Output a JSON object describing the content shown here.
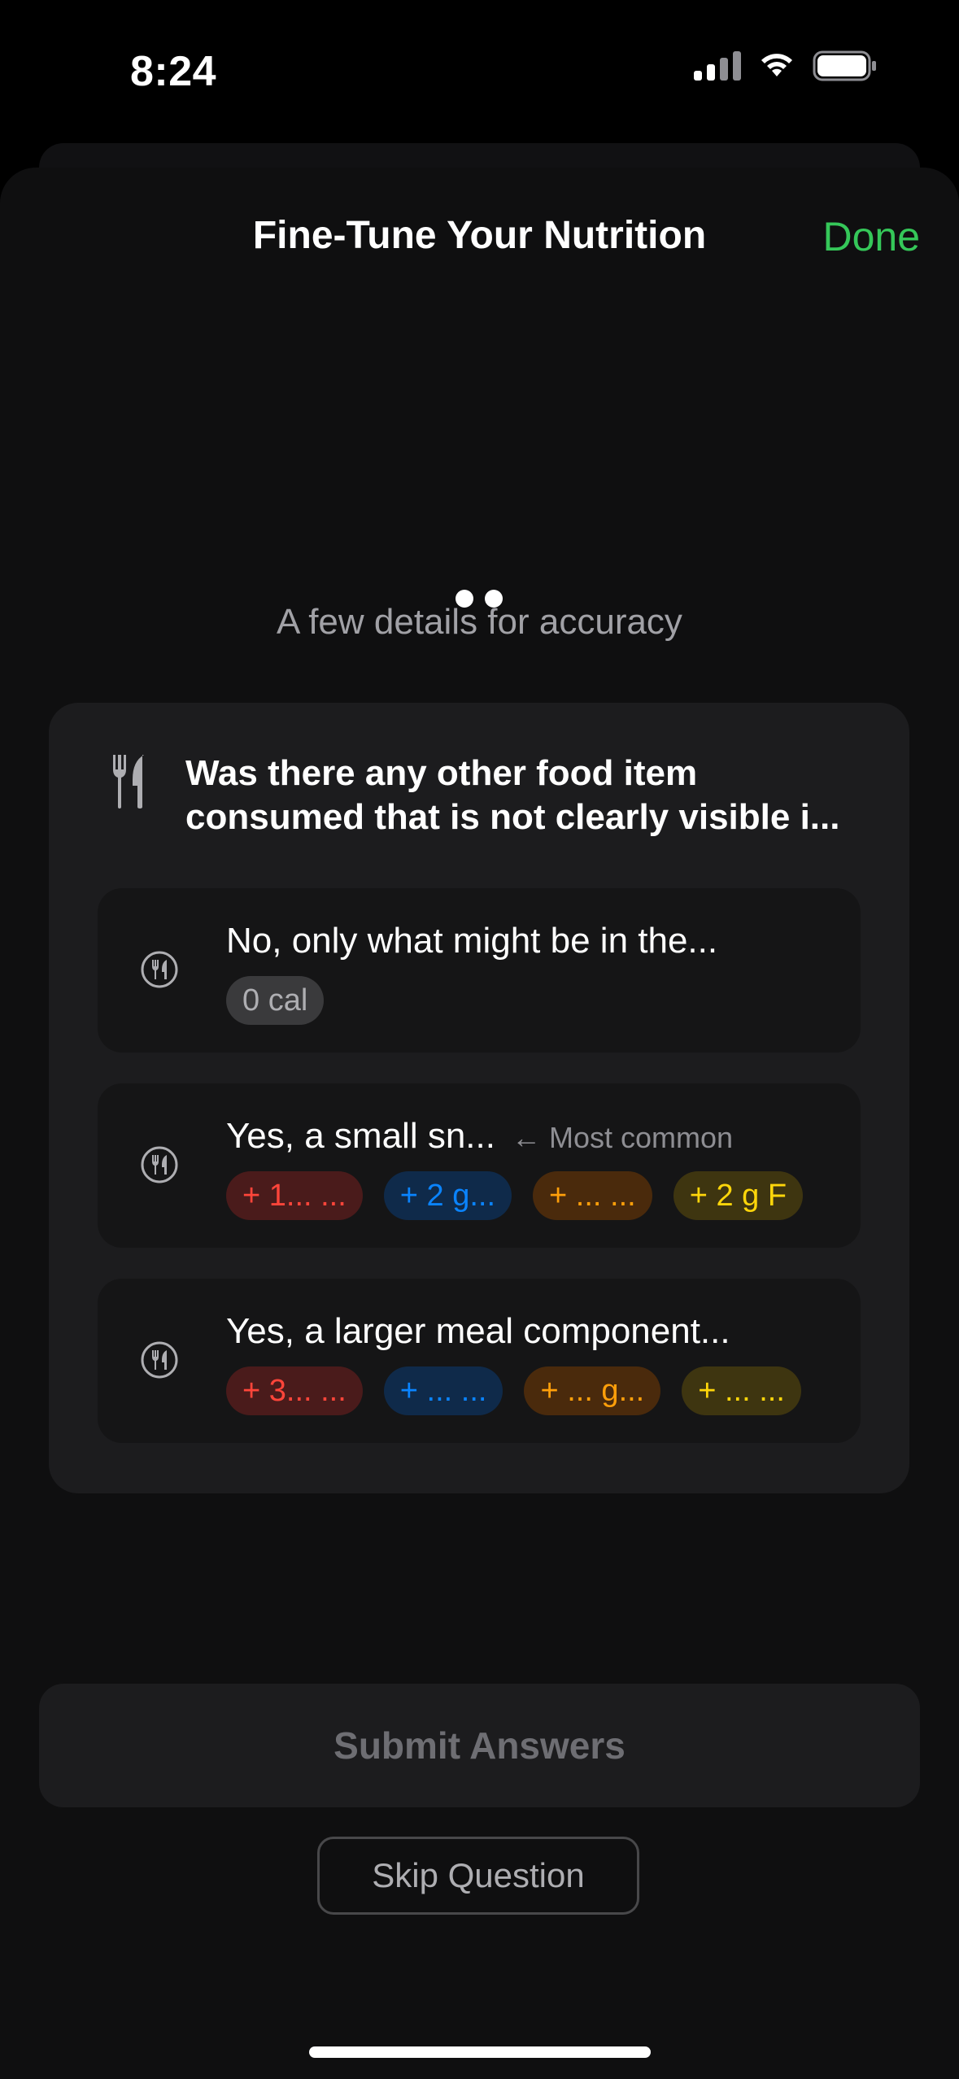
{
  "status_bar": {
    "time": "8:24"
  },
  "header": {
    "title": "Fine-Tune Your Nutrition",
    "done_label": "Done"
  },
  "subtitle": "A few details for accuracy",
  "question": {
    "text": "Was there any other food item consumed that is not clearly visible i...",
    "icon": "fork-knife-icon",
    "options": [
      {
        "label": "No, only what might be in the...",
        "tag": "",
        "pills": [
          {
            "text": "0 cal",
            "color": "gray"
          }
        ]
      },
      {
        "label": "Yes, a small sn...",
        "tag": "← Most common",
        "pills": [
          {
            "text": "+ 1... ...",
            "color": "red"
          },
          {
            "text": "+ 2 g...",
            "color": "blue"
          },
          {
            "text": "+ ... ...",
            "color": "orange"
          },
          {
            "text": "+ 2 g F",
            "color": "yellow"
          }
        ]
      },
      {
        "label": "Yes, a larger meal component...",
        "tag": "",
        "pills": [
          {
            "text": "+ 3... ...",
            "color": "red"
          },
          {
            "text": "+ ... ...",
            "color": "blue"
          },
          {
            "text": "+ ... g...",
            "color": "orange"
          },
          {
            "text": "+ ... ...",
            "color": "yellow"
          }
        ]
      }
    ]
  },
  "actions": {
    "submit_label": "Submit Answers",
    "skip_label": "Skip Question"
  },
  "colors": {
    "accent_done": "#35c759",
    "red": "#ff453a",
    "blue": "#0a84ff",
    "orange": "#ff9f0a",
    "yellow": "#ffd60a"
  }
}
